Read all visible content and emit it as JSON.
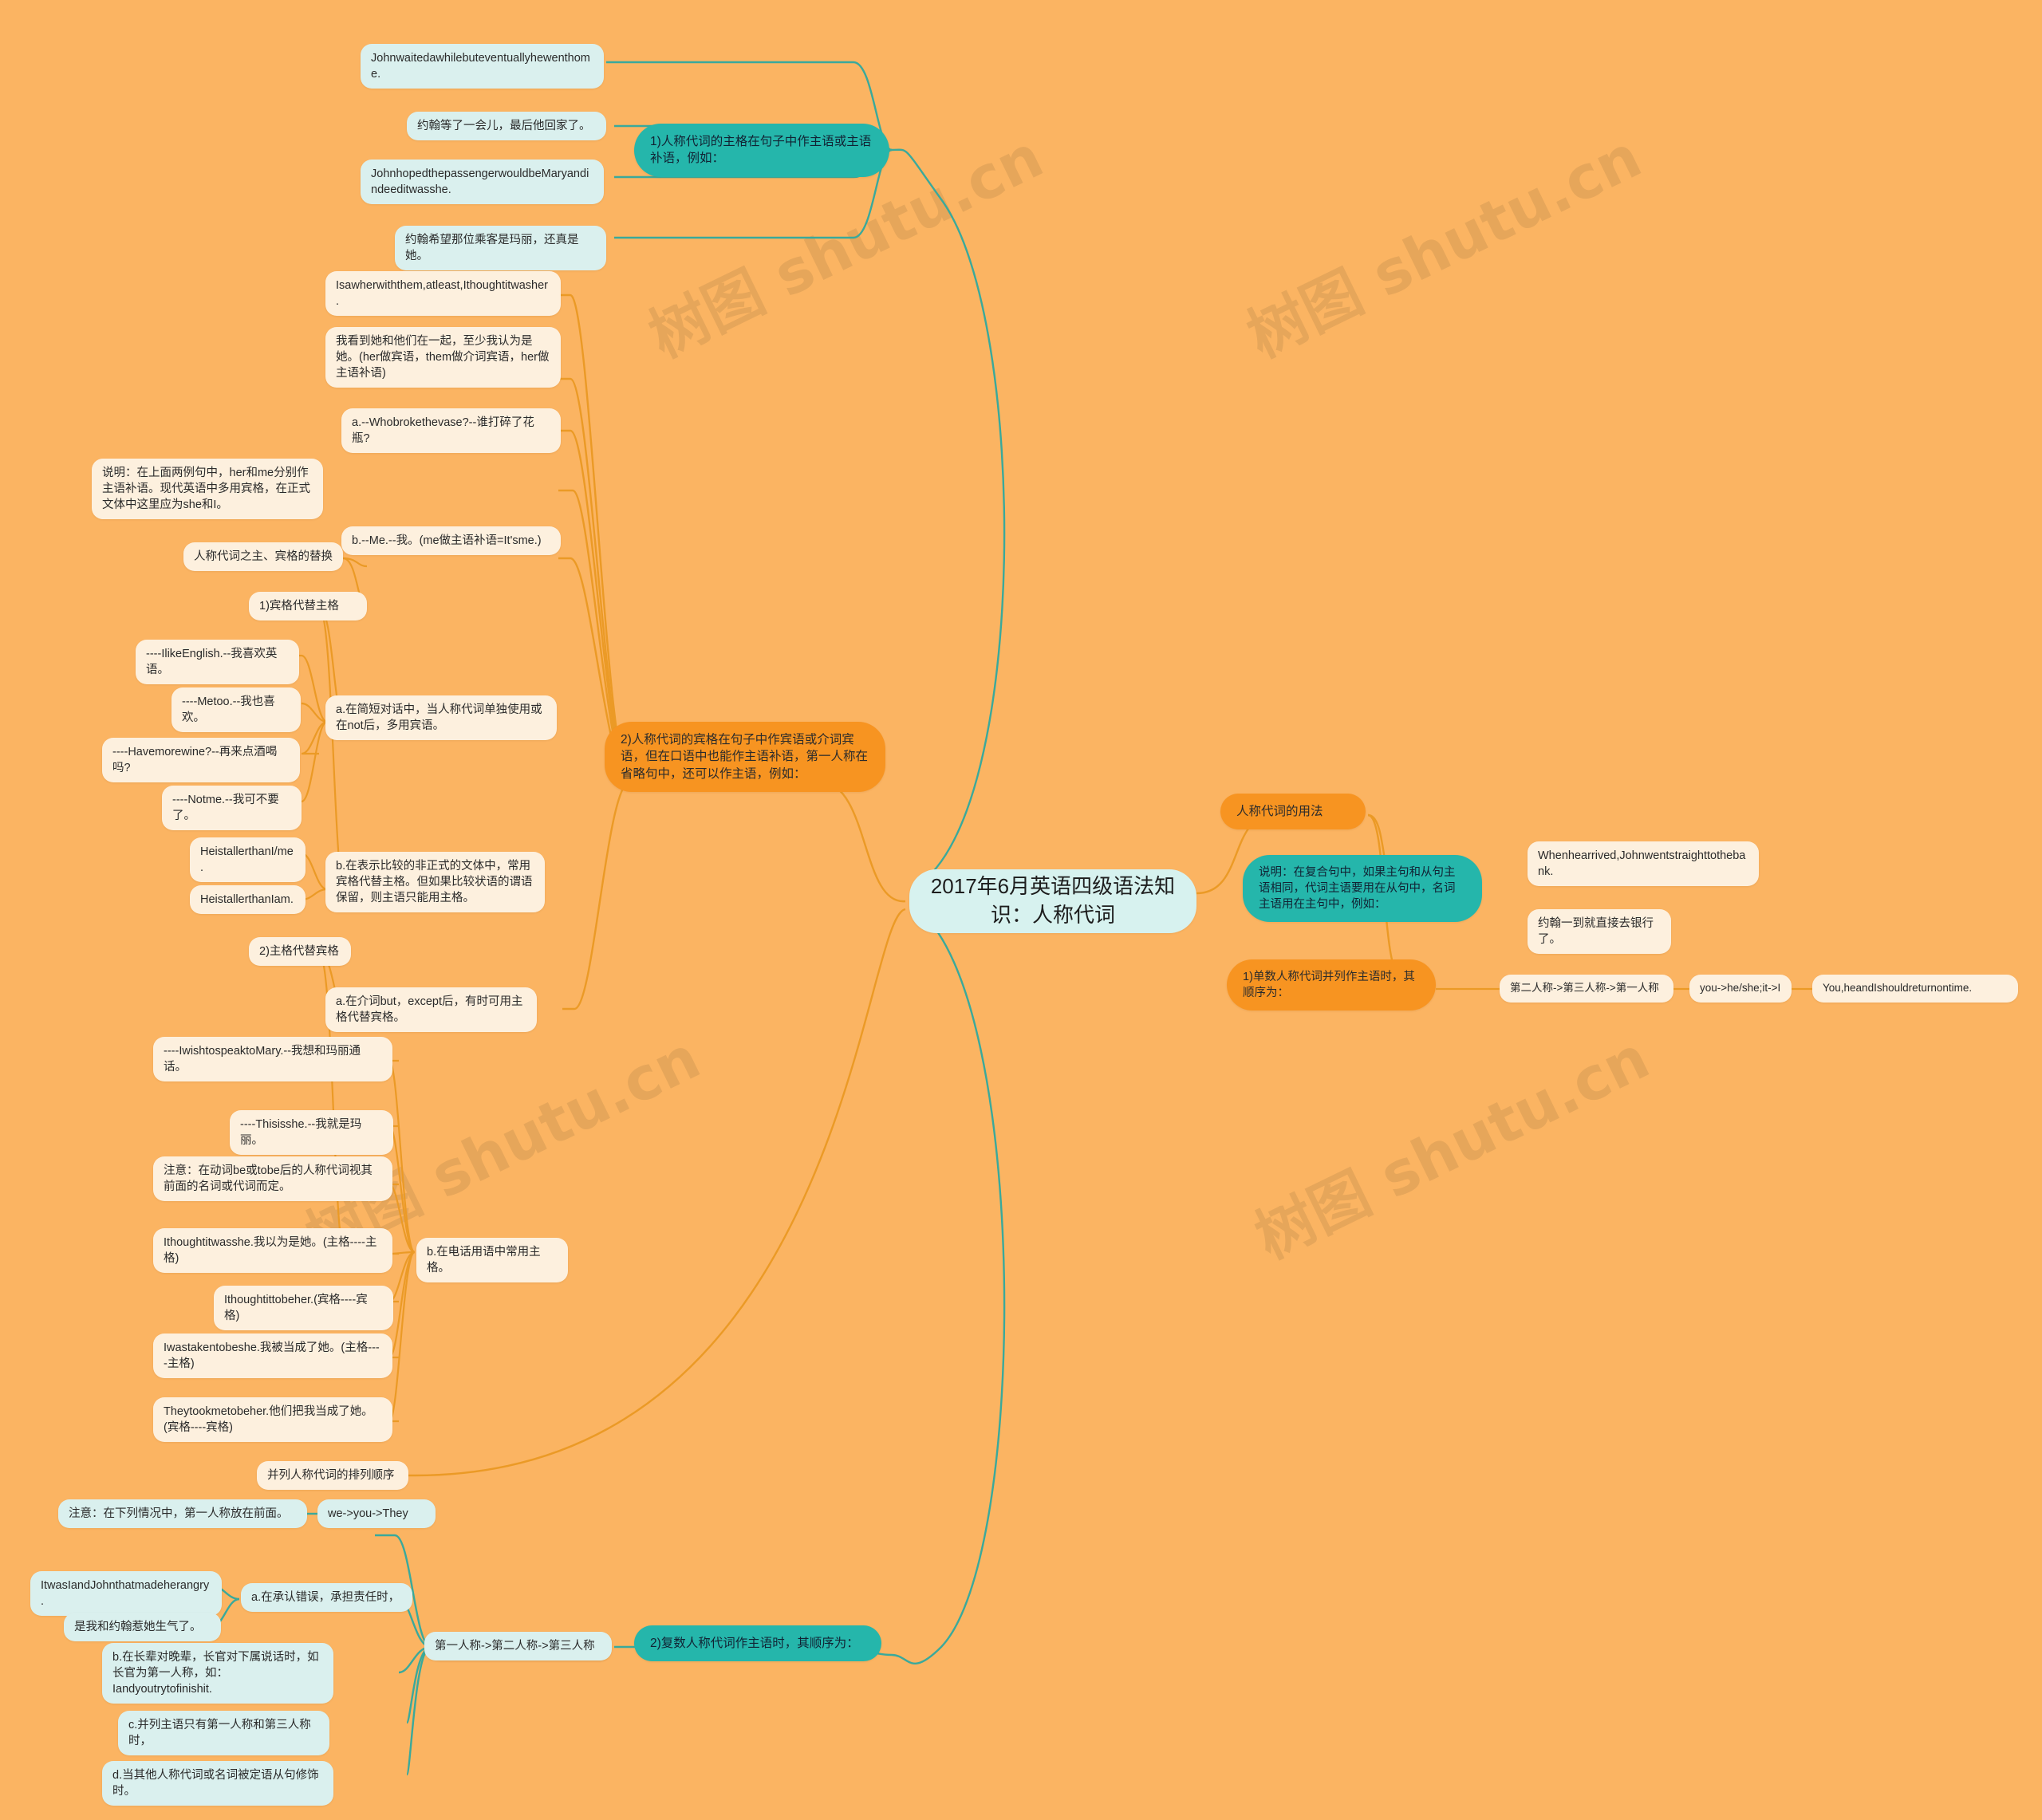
{
  "meta": {
    "title": "2017年6月英语四级语法知识：人称代词",
    "watermark": "树图 shutu.cn",
    "colors": {
      "background": "#fbb462",
      "teal_node": "#25b6ab",
      "orange_node": "#f79421",
      "cream_node": "#fdf0de",
      "mint_node": "#daf0ee",
      "root_node": "#d7f2ef",
      "teal_link": "#3aa99b",
      "orange_link": "#f0981f"
    }
  },
  "root": {
    "label": "2017年6月英语四级语法知识：人称代词"
  },
  "branches": {
    "b1": {
      "label": "1)人称代词的主格在句子中作主语或主语补语，例如：",
      "children": [
        {
          "label": "Johnwaitedawhilebuteventuallyhewenthome."
        },
        {
          "label": "约翰等了一会儿，最后他回家了。"
        },
        {
          "label": "JohnhopedthepassengerwouldbeMaryandindeeditwasshe."
        },
        {
          "label": "约翰希望那位乘客是玛丽，还真是她。"
        }
      ]
    },
    "b2": {
      "label": "2)人称代词的宾格在句子中作宾语或介词宾语，但在口语中也能作主语补语，第一人称在省略句中，还可以作主语，例如：",
      "examples": [
        {
          "label": "Isawherwiththem,atleast,Ithoughtitwasher."
        },
        {
          "label": "我看到她和他们在一起，至少我认为是她。(her做宾语，them做介词宾语，her做主语补语)"
        },
        {
          "label": "a.--Whobrokethevase?--谁打碎了花瓶?"
        },
        {
          "label": "b.--Me.--我。(me做主语补语=It'sme.)"
        },
        {
          "label": "说明：在上面两例句中，her和me分别作主语补语。现代英语中多用宾格，在正式文体中这里应为she和I。"
        }
      ],
      "substitution": {
        "label": "人称代词之主、宾格的替换",
        "groups": [
          {
            "label": "1)宾格代替主格",
            "rules": [
              {
                "label": "a.在简短对话中，当人称代词单独使用或在not后，多用宾语。",
                "examples": [
                  "----IlikeEnglish.--我喜欢英语。",
                  "----Metoo.--我也喜欢。",
                  "----Havemorewine?--再来点酒喝吗?",
                  "----Notme.--我可不要了。"
                ]
              },
              {
                "label": "b.在表示比较的非正式的文体中，常用宾格代替主格。但如果比较状语的谓语保留，则主语只能用主格。",
                "examples": [
                  "HeistallerthanI/me.",
                  "HeistallerthanIam."
                ]
              }
            ]
          },
          {
            "label": "2)主格代替宾格",
            "rules": [
              {
                "label": "a.在介词but，except后，有时可用主格代替宾格。",
                "examples": []
              },
              {
                "label": "b.在电话用语中常用主格。",
                "examples": [
                  "----IwishtospeaktoMary.--我想和玛丽通话。",
                  "----Thisisshe.--我就是玛丽。",
                  "注意：在动词be或tobe后的人称代词视其前面的名词或代词而定。",
                  "Ithoughtitwasshe.我以为是她。(主格----主格)",
                  "Ithoughtittobeher.(宾格----宾格)",
                  "Iwastakentobeshe.我被当成了她。(主格----主格)",
                  "Theytookmetobeher.他们把我当成了她。(宾格----宾格)"
                ]
              }
            ]
          }
        ]
      }
    },
    "b3": {
      "label": "并列人称代词的排列顺序"
    },
    "b4": {
      "label": "2)复数人称代词作主语时，其顺序为：",
      "order": "第一人称->第二人称->第三人称",
      "order_en": "we->you->They",
      "note": "注意：在下列情况中，第一人称放在前面。",
      "cases": [
        {
          "label": "a.在承认错误，承担责任时，",
          "examples": [
            "ItwasIandJohnthatmadeherangry.",
            "是我和约翰惹她生气了。"
          ]
        },
        {
          "label": "b.在长辈对晚辈，长官对下属说话时，如长官为第一人称，如：Iandyoutrytofinishit.",
          "examples": []
        },
        {
          "label": "c.并列主语只有第一人称和第三人称时，",
          "examples": []
        },
        {
          "label": "d.当其他人称代词或名词被定语从句修饰时。",
          "examples": []
        }
      ]
    },
    "b5": {
      "label": "人称代词的用法",
      "note": {
        "label": "说明：在复合句中，如果主句和从句主语相同，代词主语要用在从句中，名词主语用在主句中，例如：",
        "examples": [
          "Whenhearrived,Johnwentstraighttothebank.",
          "约翰一到就直接去银行了。"
        ]
      },
      "singular": {
        "label": "1)单数人称代词并列作主语时，其顺序为：",
        "order": "第二人称->第三人称->第一人称",
        "order_en": "you->he/she;it->I",
        "example": "You,heandIshouldreturnontime."
      }
    }
  }
}
